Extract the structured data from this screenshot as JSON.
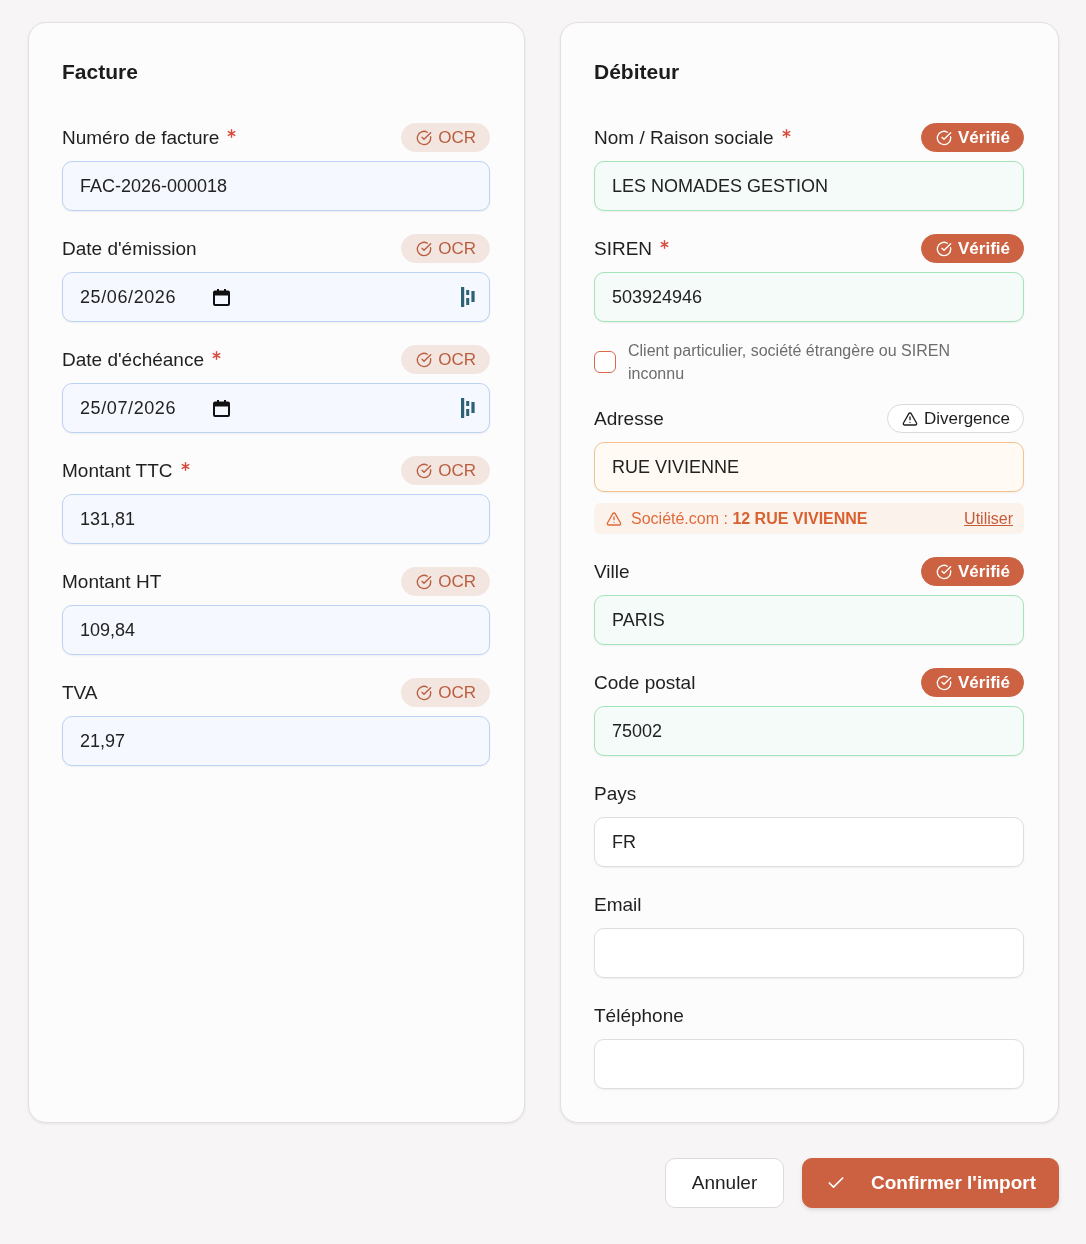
{
  "panels": [
    {
      "title": "Facture",
      "fields": [
        {
          "kind": "text",
          "label": "Numéro de facture",
          "required": true,
          "badge": {
            "kind": "ocr",
            "text": "OCR"
          },
          "value": "FAC-2026-000018"
        },
        {
          "kind": "date",
          "label": "Date d'émission",
          "required": false,
          "badge": {
            "kind": "ocr",
            "text": "OCR"
          },
          "value": "25/06/2026"
        },
        {
          "kind": "date",
          "label": "Date d'échéance",
          "required": true,
          "badge": {
            "kind": "ocr",
            "text": "OCR"
          },
          "value": "25/07/2026"
        },
        {
          "kind": "text",
          "label": "Montant TTC",
          "required": true,
          "badge": {
            "kind": "ocr",
            "text": "OCR"
          },
          "value": "131,81"
        },
        {
          "kind": "text",
          "label": "Montant HT",
          "required": false,
          "badge": {
            "kind": "ocr",
            "text": "OCR"
          },
          "value": "109,84"
        },
        {
          "kind": "text",
          "label": "TVA",
          "required": false,
          "badge": {
            "kind": "ocr",
            "text": "OCR"
          },
          "value": "21,97"
        }
      ]
    },
    {
      "title": "Débiteur",
      "fields": [
        {
          "kind": "text",
          "label": "Nom / Raison sociale",
          "required": true,
          "badge": {
            "kind": "verified",
            "text": "Vérifié"
          },
          "value": "LES NOMADES GESTION"
        },
        {
          "kind": "text",
          "label": "SIREN",
          "required": true,
          "badge": {
            "kind": "verified",
            "text": "Vérifié"
          },
          "value": "503924946"
        },
        {
          "kind": "checkbox",
          "label": "Client particulier, société étrangère ou SIREN inconnu",
          "checked": false
        },
        {
          "kind": "text",
          "label": "Adresse",
          "required": false,
          "badge": {
            "kind": "divergence",
            "text": "Divergence"
          },
          "value": "RUE VIVIENNE",
          "alert": {
            "text": "Société.com : **12 RUE VIVIENNE**",
            "action": "Utiliser"
          }
        },
        {
          "kind": "text",
          "label": "Ville",
          "required": false,
          "badge": {
            "kind": "verified",
            "text": "Vérifié"
          },
          "value": "PARIS"
        },
        {
          "kind": "text",
          "label": "Code postal",
          "required": false,
          "badge": {
            "kind": "verified",
            "text": "Vérifié"
          },
          "value": "75002"
        },
        {
          "kind": "text",
          "label": "Pays",
          "required": false,
          "value": "FR"
        },
        {
          "kind": "text",
          "label": "Email",
          "required": false
        },
        {
          "kind": "text",
          "label": "Téléphone",
          "required": false
        }
      ]
    }
  ],
  "buttons": [
    {
      "kind": "secondary",
      "label": "Annuler"
    },
    {
      "kind": "primary",
      "label": "Confirmer l'import"
    }
  ]
}
